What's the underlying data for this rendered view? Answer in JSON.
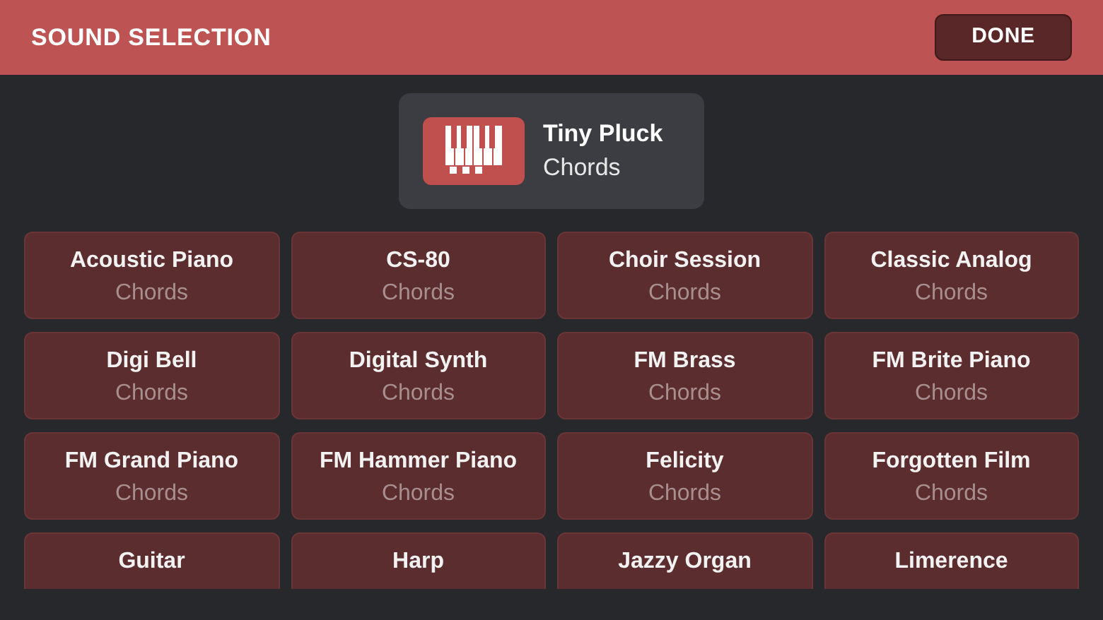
{
  "header": {
    "title": "SOUND SELECTION",
    "done_button": "DONE"
  },
  "current_sound": {
    "name": "Tiny Pluck",
    "category": "Chords"
  },
  "sounds": [
    {
      "name": "Acoustic Piano",
      "category": "Chords"
    },
    {
      "name": "CS-80",
      "category": "Chords"
    },
    {
      "name": "Choir Session",
      "category": "Chords"
    },
    {
      "name": "Classic Analog",
      "category": "Chords"
    },
    {
      "name": "Digi Bell",
      "category": "Chords"
    },
    {
      "name": "Digital Synth",
      "category": "Chords"
    },
    {
      "name": "FM Brass",
      "category": "Chords"
    },
    {
      "name": "FM Brite Piano",
      "category": "Chords"
    },
    {
      "name": "FM Grand Piano",
      "category": "Chords"
    },
    {
      "name": "FM Hammer Piano",
      "category": "Chords"
    },
    {
      "name": "Felicity",
      "category": "Chords"
    },
    {
      "name": "Forgotten Film",
      "category": "Chords"
    },
    {
      "name": "Guitar"
    },
    {
      "name": "Harp"
    },
    {
      "name": "Jazzy Organ"
    },
    {
      "name": "Limerence"
    }
  ]
}
